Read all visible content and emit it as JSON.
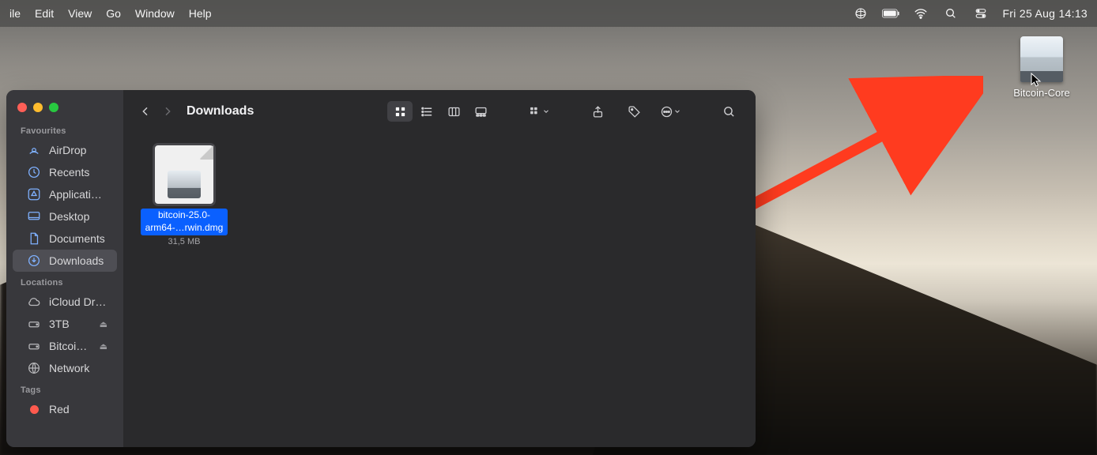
{
  "menubar": {
    "left_items": [
      "ile",
      "Edit",
      "View",
      "Go",
      "Window",
      "Help"
    ],
    "clock": "Fri 25 Aug  14:13"
  },
  "desktop": {
    "mounted_volume_name": "Bitcoin-Core"
  },
  "finder": {
    "title": "Downloads",
    "sidebar": {
      "sections": [
        {
          "heading": "Favourites",
          "items": [
            {
              "id": "airdrop",
              "label": "AirDrop",
              "icon": "airdrop",
              "selected": false
            },
            {
              "id": "recents",
              "label": "Recents",
              "icon": "clock",
              "selected": false
            },
            {
              "id": "applications",
              "label": "Applications",
              "icon": "apps",
              "selected": false
            },
            {
              "id": "desktop",
              "label": "Desktop",
              "icon": "desktop",
              "selected": false
            },
            {
              "id": "documents",
              "label": "Documents",
              "icon": "document",
              "selected": false
            },
            {
              "id": "downloads",
              "label": "Downloads",
              "icon": "download",
              "selected": true
            }
          ]
        },
        {
          "heading": "Locations",
          "items": [
            {
              "id": "icloud",
              "label": "iCloud Drive",
              "icon": "cloud",
              "selected": false
            },
            {
              "id": "3tb",
              "label": "3TB",
              "icon": "drive",
              "selected": false,
              "ejectable": true
            },
            {
              "id": "bitcoin",
              "label": "Bitcoin…",
              "icon": "drive",
              "selected": false,
              "ejectable": true
            },
            {
              "id": "network",
              "label": "Network",
              "icon": "network",
              "selected": false
            }
          ]
        },
        {
          "heading": "Tags",
          "items": [
            {
              "id": "red",
              "label": "Red",
              "icon": "tag-red",
              "selected": false
            }
          ]
        }
      ]
    },
    "files": [
      {
        "name": "bitcoin-25.0-arm64-…rwin.dmg",
        "size": "31,5 MB",
        "selected": true
      }
    ],
    "toolbar": {
      "view_mode": "icons"
    }
  }
}
